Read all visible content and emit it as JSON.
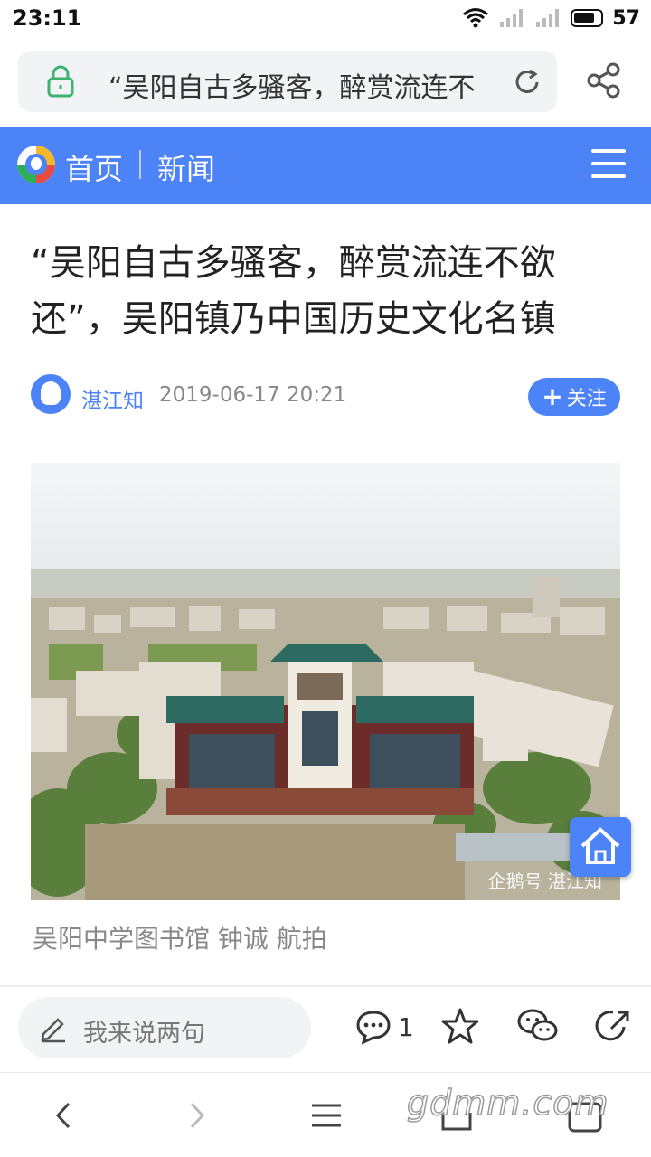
{
  "status_bar": {
    "time": "23:11",
    "battery": "57"
  },
  "url_bar": {
    "text": "“吴阳自古多骚客，醉赏流连不"
  },
  "nav": {
    "home": "首页",
    "section": "新闻"
  },
  "article": {
    "title": "“吴阳自古多骚客，醉赏流连不欲还”，吴阳镇乃中国历史文化名镇",
    "author": "湛江知",
    "time": "2019-06-17 20:21",
    "follow_label": "关注",
    "photo_caption": "吴阳中学图书馆 钟诚 航拍",
    "photo_watermark": "企鹅号 湛江知"
  },
  "comment_bar": {
    "placeholder": "我来说两句",
    "comment_count": "1"
  },
  "site_watermark": "gdmm.com",
  "colors": {
    "accent": "#4c83f6",
    "lock": "#3cb371"
  }
}
